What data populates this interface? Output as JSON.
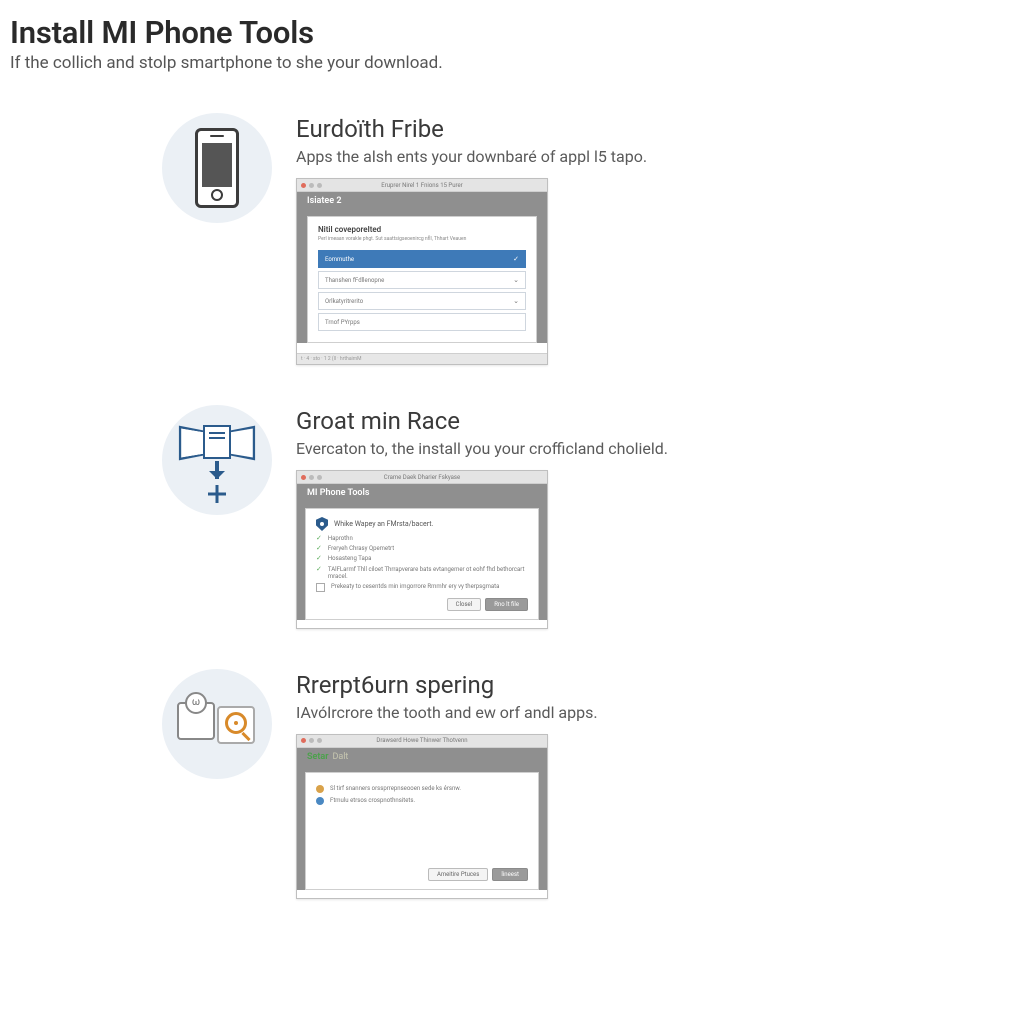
{
  "header": {
    "title": "Install MI Phone Tools",
    "subtitle": "If the collich and stolp smartphone to she your download."
  },
  "steps": [
    {
      "title": "Eurdoïth Fribe",
      "desc": "Apps the alsh ents your downbaré of appl l5 tapo.",
      "window": {
        "titlebar": "Eruprer Nirel 1 Fnions 15 Purer",
        "heading": "Isiatee 2",
        "panel_title": "Nitil coveporelted",
        "panel_sub": "Perl imeaan vorakle phgt. Sut saattsigseoenircg nfll, Thhart Veauen",
        "rows": [
          {
            "label": "Eommuthe",
            "active": true
          },
          {
            "label": "Thanshen fFdllenopne",
            "active": false
          },
          {
            "label": "Orlkatyritrerito",
            "active": false
          },
          {
            "label": "Trnof PYrpps",
            "active": false
          }
        ],
        "footer": "t · 4 · sto · 1 2 (ll · hrthaimM"
      }
    },
    {
      "title": "Groat min Race",
      "desc": "Evercaton to, the install you your crofficland cholield.",
      "window": {
        "titlebar": "Crame Daek Dharier Fskyase",
        "heading": "MI Phone Tools",
        "lead": "Whike Wapey an FMrsta/bacert.",
        "checks": [
          "Haprothn",
          "Freryeh Chrasy Qpemetrt",
          "Hosasteng Tapa",
          "TAlFLarmf Thll ciloet Thrrapverare bats evtangemer ot eohf fhd bethorcart mracel."
        ],
        "checkbox": "Prekeaty to cesentds min imgorrore Rmmhr ery vy therpsgmata",
        "btn_cancel": "Closel",
        "btn_primary": "Rno lt file"
      }
    },
    {
      "title": "Rrerpt6urn spering",
      "desc": "IAvólrcrore the tooth and ew orf andl apps.",
      "window": {
        "titlebar": "Drawserd Howe Thinwer Thotvenn",
        "heading": "Setar",
        "heading_sub": "Dalt",
        "items": [
          "Sl tirf  snanners orssprrepnseooen sede ks érsnw.",
          "Ftmulu etrsos crospnothnsitets."
        ],
        "btn_left": "Ameitire Ptuces",
        "btn_right": "lineest"
      }
    }
  ]
}
